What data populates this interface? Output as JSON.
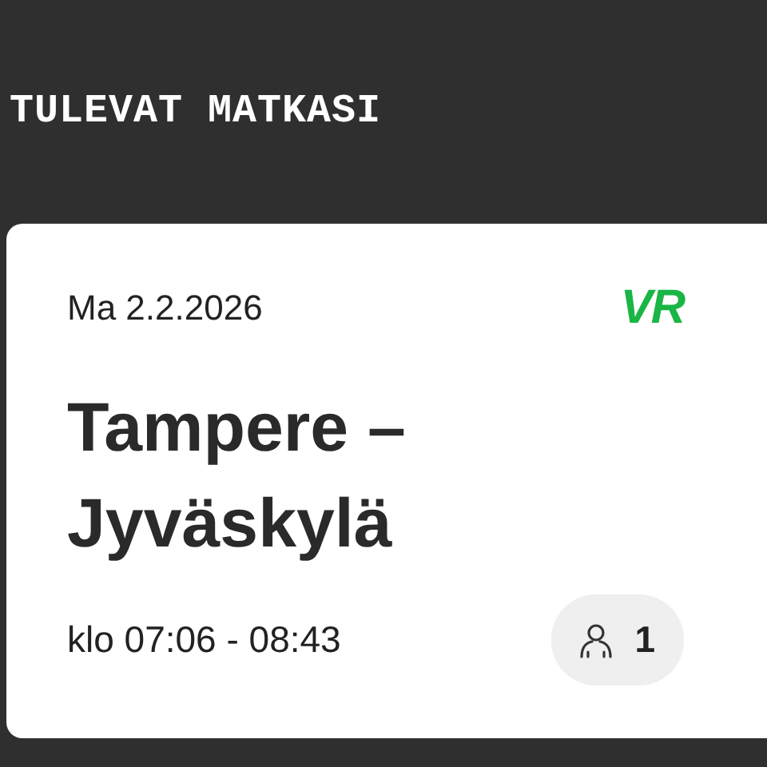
{
  "header": {
    "title": "TULEVAT MATKASI"
  },
  "trip": {
    "date": "Ma 2.2.2026",
    "logo": "VR",
    "route_lines": [
      "Tampere –",
      "Jyväskylä"
    ],
    "time": "klo 07:06 - 08:43",
    "passengers": "1"
  }
}
